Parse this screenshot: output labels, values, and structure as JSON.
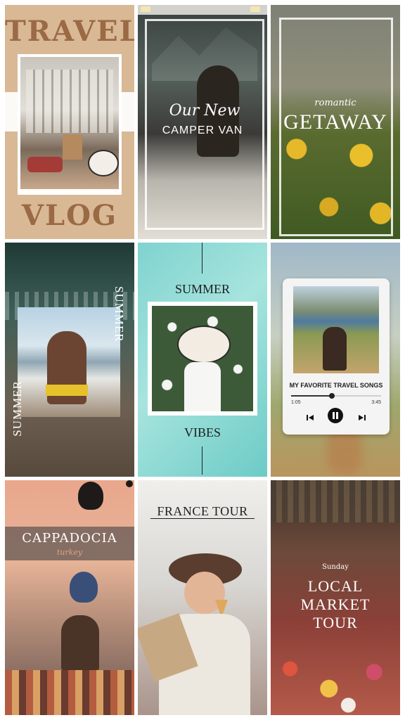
{
  "tile1": {
    "top_text": "TRAVEL",
    "bottom_text": "VLOG"
  },
  "tile2": {
    "script_text": "Our New",
    "main_text": "CAMPER VAN"
  },
  "tile3": {
    "script_text": "romantic",
    "main_text": "GETAWAY"
  },
  "tile4": {
    "right_text": "SUMMER",
    "left_text": "SUMMER"
  },
  "tile5": {
    "top_text": "SUMMER",
    "bottom_text": "VIBES"
  },
  "tile6": {
    "title": "MY FAVORITE TRAVEL SONGS",
    "time_elapsed": "1:05",
    "time_total": "3:45",
    "progress": 0.45
  },
  "tile7": {
    "title": "CAPPADOCIA",
    "subtitle": "turkey"
  },
  "tile8": {
    "title": "FRANCE TOUR"
  },
  "tile9": {
    "day": "Sunday",
    "line1": "LOCAL",
    "line2": "MARKET",
    "line3": "TOUR"
  },
  "icons": [
    "prev-track-icon",
    "pause-icon",
    "next-track-icon"
  ],
  "colors": {
    "tan": "#d9b895",
    "brown_text": "#9a6a45",
    "mint": "#7fd3cf",
    "dark_ink": "#1f1f1f"
  }
}
